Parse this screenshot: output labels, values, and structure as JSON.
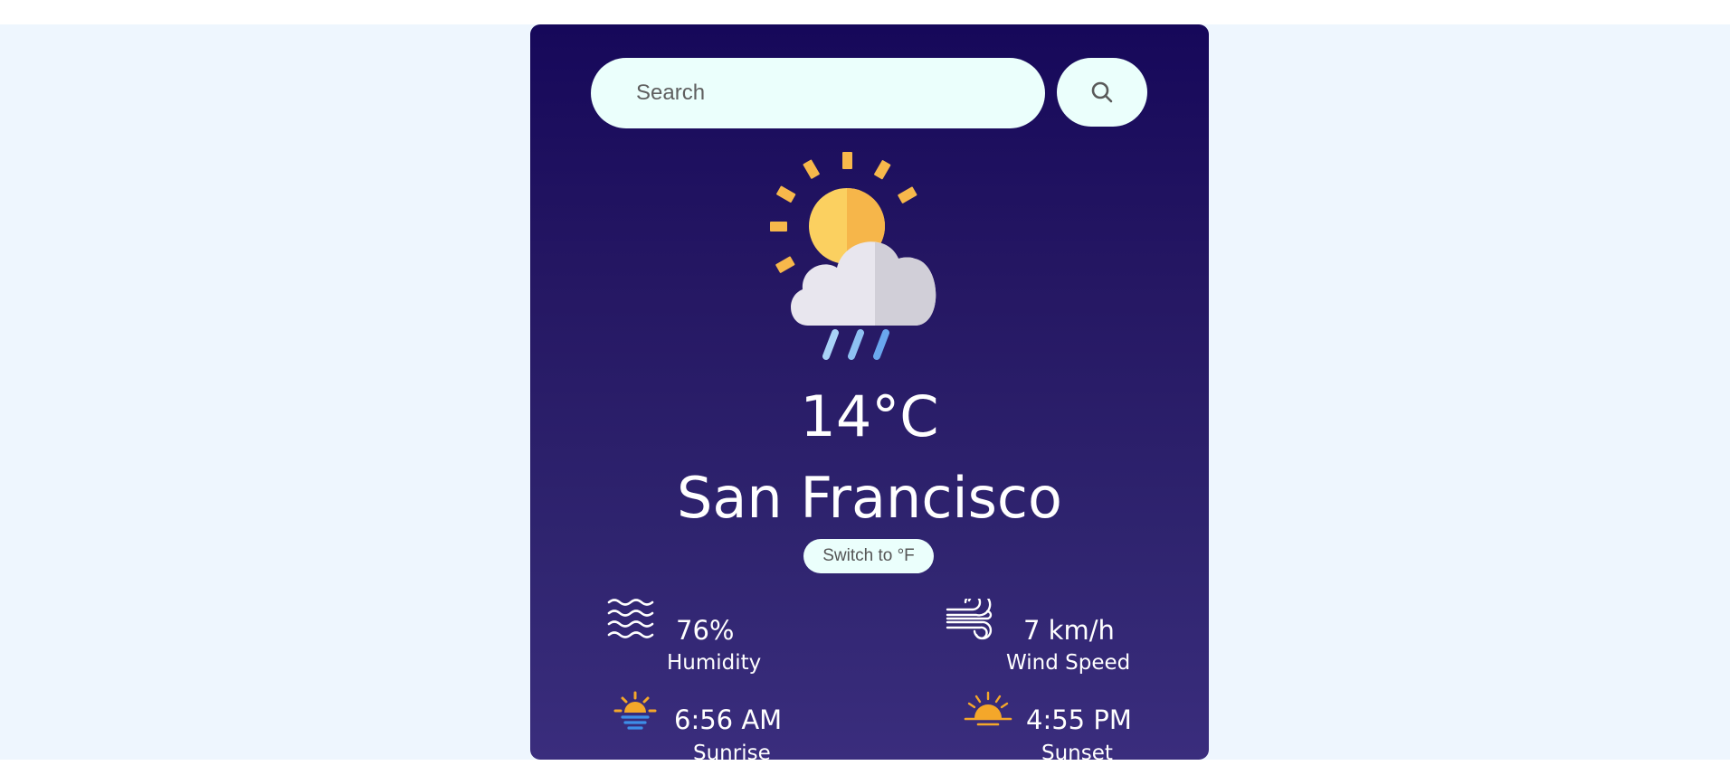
{
  "search": {
    "placeholder": "Search"
  },
  "icons": {
    "search": "search-icon",
    "weather": "sun-cloud-rain-icon",
    "humidity": "humidity-waves-icon",
    "wind": "wind-icon",
    "sunrise": "sunrise-icon",
    "sunset": "sunset-icon"
  },
  "weather": {
    "temperature": "14°C",
    "city": "San Francisco",
    "unit_toggle_label": "Switch to °F"
  },
  "details": {
    "humidity": {
      "value": "76%",
      "label": "Humidity"
    },
    "wind": {
      "value": "7 km/h",
      "label": "Wind Speed"
    },
    "sunrise": {
      "value": "6:56 AM",
      "label": "Sunrise"
    },
    "sunset": {
      "value": "4:55 PM",
      "label": "Sunset"
    }
  },
  "colors": {
    "card_top": "#16085a",
    "card_bottom": "#3a2d7d",
    "page_background": "#eef6fe",
    "input_background": "#ebfffc",
    "sun": "#f9c74f",
    "accent_orange": "#f4a72a"
  }
}
